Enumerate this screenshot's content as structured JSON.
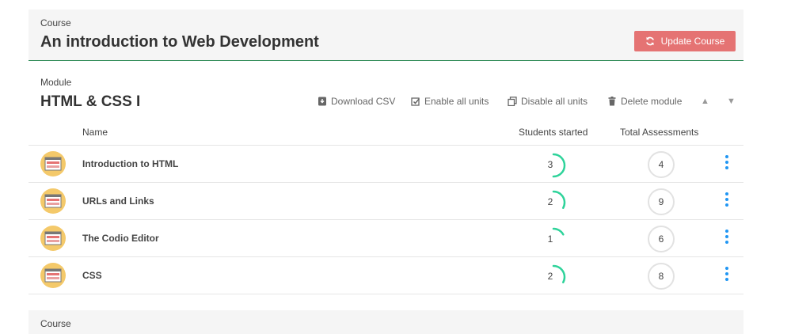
{
  "course": {
    "label": "Course",
    "title": "An introduction to Web Development",
    "update_button": "Update Course",
    "accent_color": "#e57373",
    "divider_color": "#2e8b57"
  },
  "module": {
    "label": "Module",
    "title": "HTML & CSS I",
    "actions": {
      "download_csv": "Download CSV",
      "enable_all": "Enable all units",
      "disable_all": "Disable all units",
      "delete_module": "Delete module"
    }
  },
  "table": {
    "headers": {
      "name": "Name",
      "students_started": "Students started",
      "total_assessments": "Total Assessments"
    },
    "rows": [
      {
        "name": "Introduction to HTML",
        "started": "3",
        "assessments": "4",
        "progress": 0.5
      },
      {
        "name": "URLs and Links",
        "started": "2",
        "assessments": "9",
        "progress": 0.33
      },
      {
        "name": "The Codio Editor",
        "started": "1",
        "assessments": "6",
        "progress": 0.17
      },
      {
        "name": "CSS",
        "started": "2",
        "assessments": "8",
        "progress": 0.33
      }
    ]
  },
  "next_course": {
    "label": "Course"
  },
  "icons": {
    "update": "refresh-icon",
    "download": "download-icon",
    "enable": "checklist-icon",
    "disable": "copy-icon",
    "delete": "trash-icon",
    "up": "arrow-up-icon",
    "down": "arrow-down-icon",
    "menu": "kebab-menu-icon"
  },
  "colors": {
    "progress": "#2ed39a",
    "menu": "#2196f3"
  }
}
